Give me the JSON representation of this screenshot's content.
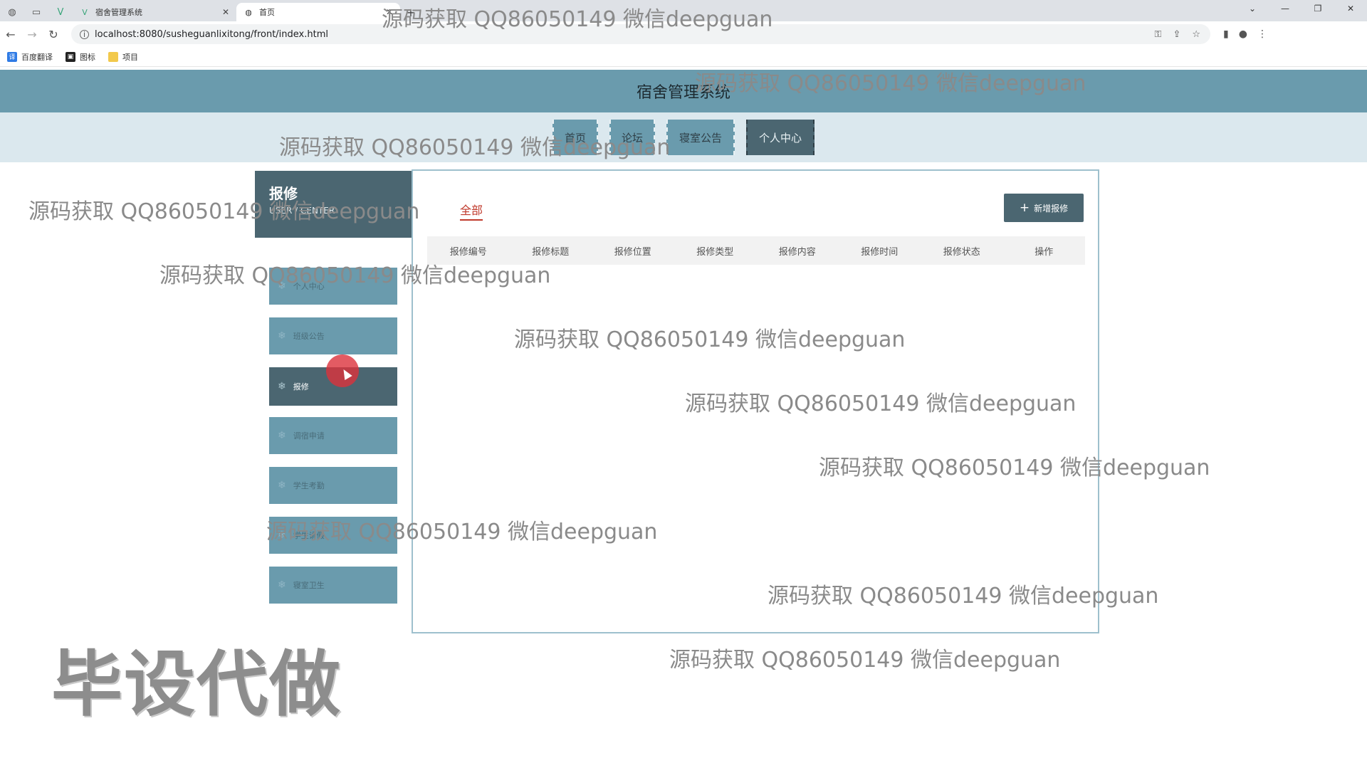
{
  "browser": {
    "tabs": [
      {
        "label": "宿舍管理系统",
        "active": false
      },
      {
        "label": "首页",
        "active": true
      }
    ],
    "url": "localhost:8080/susheguanlixitong/front/index.html",
    "bookmarks": [
      "百度翻译",
      "图标",
      "项目"
    ]
  },
  "header": {
    "title": "宿舍管理系统"
  },
  "nav": {
    "items": [
      {
        "label": "首页",
        "active": false
      },
      {
        "label": "论坛",
        "active": false
      },
      {
        "label": "寝室公告",
        "active": false
      },
      {
        "label": "个人中心",
        "active": true
      }
    ]
  },
  "sidebar": {
    "title": "报修",
    "subtitle": "USER / CENTER",
    "items": [
      {
        "label": "个人中心",
        "active": false
      },
      {
        "label": "班级公告",
        "active": false
      },
      {
        "label": "报修",
        "active": true
      },
      {
        "label": "调宿申请",
        "active": false
      },
      {
        "label": "学生考勤",
        "active": false
      },
      {
        "label": "学生请假",
        "active": false
      },
      {
        "label": "寝室卫生",
        "active": false
      }
    ]
  },
  "content": {
    "filter_tab": "全部",
    "add_button": "新增报修",
    "columns": [
      "报修编号",
      "报修标题",
      "报修位置",
      "报修类型",
      "报修内容",
      "报修时间",
      "报修状态",
      "操作"
    ]
  },
  "watermarks": {
    "text": "源码获取 QQ86050149 微信deepguan",
    "big": "毕设代做"
  },
  "colors": {
    "header": "#6a9bad",
    "dark": "#4b6671",
    "accent_red": "#c0392b"
  }
}
